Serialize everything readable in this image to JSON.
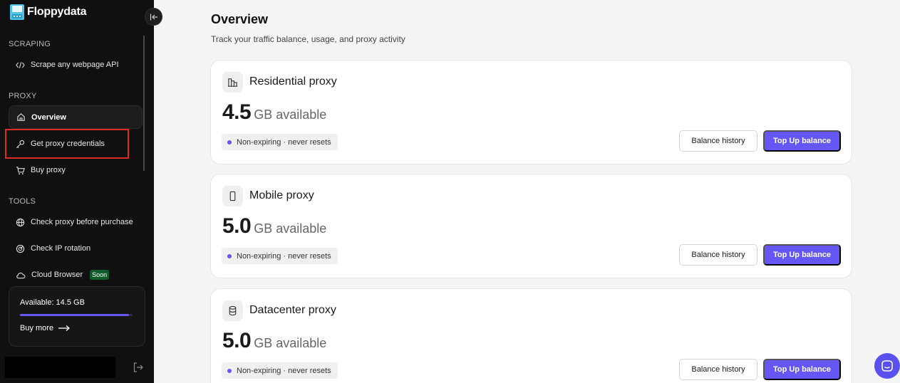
{
  "brand": {
    "name": "Floppydata"
  },
  "sidebar": {
    "sections": [
      {
        "title": "SCRAPING"
      },
      {
        "title": "PROXY"
      },
      {
        "title": "TOOLS"
      }
    ],
    "items": [
      {
        "label": "Scrape any webpage API",
        "icon": "code-icon"
      },
      {
        "label": "Overview",
        "icon": "home-icon",
        "active": true
      },
      {
        "label": "Get proxy credentials",
        "icon": "key-icon",
        "highlighted": true
      },
      {
        "label": "Buy proxy",
        "icon": "cart-icon"
      },
      {
        "label": "Check proxy before purchase",
        "icon": "globe-icon"
      },
      {
        "label": "Check IP rotation",
        "icon": "rotation-icon"
      },
      {
        "label": "Cloud Browser",
        "icon": "cloud-icon",
        "badge": "Soon"
      }
    ],
    "balance": {
      "label": "Available: 14.5 GB",
      "progress_fraction": 0.97,
      "buy_more": "Buy more"
    }
  },
  "main": {
    "title": "Overview",
    "subtitle": "Track your traffic balance, usage, and proxy activity",
    "cards": [
      {
        "title": "Residential proxy",
        "icon": "building-icon",
        "amount": "4.5",
        "unit": "GB available",
        "tag": "Non-expiring · never resets",
        "history_label": "Balance history",
        "topup_label": "Top Up balance"
      },
      {
        "title": "Mobile proxy",
        "icon": "phone-icon",
        "amount": "5.0",
        "unit": "GB available",
        "tag": "Non-expiring · never resets",
        "history_label": "Balance history",
        "topup_label": "Top Up balance"
      },
      {
        "title": "Datacenter proxy",
        "icon": "database-icon",
        "amount": "5.0",
        "unit": "GB available",
        "tag": "Non-expiring · never resets",
        "history_label": "Balance history",
        "topup_label": "Top Up balance"
      }
    ]
  },
  "colors": {
    "accent": "#6557f5",
    "sidebar_bg": "#101010",
    "highlight_outline": "#d92d20",
    "soon_badge": "#0f5c2a"
  }
}
